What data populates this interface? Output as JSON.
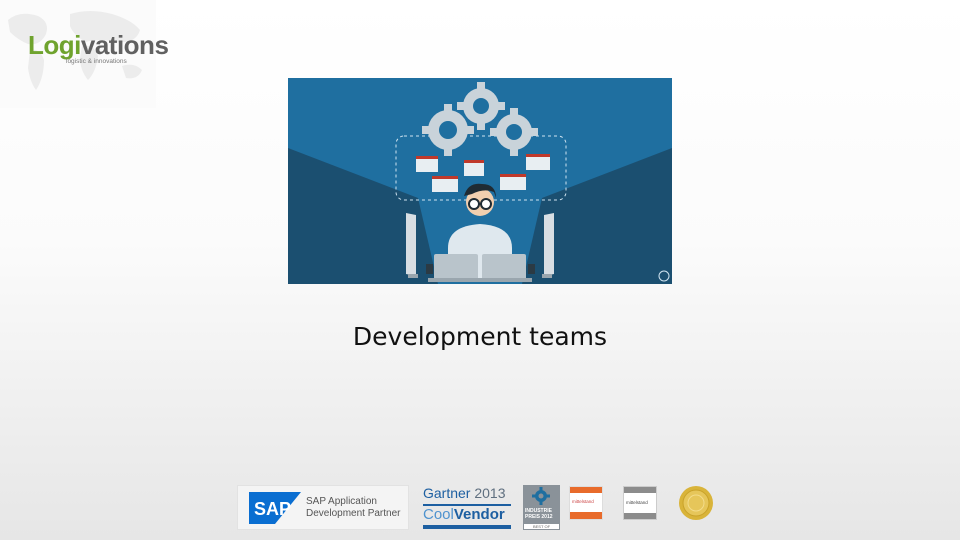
{
  "logo": {
    "brand_part1": "Logi",
    "brand_part2": "vations",
    "tagline": "logistic & innovations"
  },
  "hero": {
    "image_description_name": "developer-illustration"
  },
  "slide": {
    "title": "Development teams"
  },
  "badges": {
    "sap": {
      "mark": "SAP",
      "line1": "SAP Application",
      "line2": "Development Partner"
    },
    "gartner": {
      "brand": "Gartner",
      "year": "2013",
      "cool": "Cool",
      "vendor": "Vendor"
    },
    "industrie": {
      "line1": "INDUSTRIE",
      "line2": "PREIS",
      "year": "2012",
      "best": "BEST OF"
    },
    "innovationspreis_1": {
      "label": "mittelstand"
    },
    "innovationspreis_2": {
      "label": "mittelstand"
    }
  },
  "colors": {
    "brand_green": "#6fa32e",
    "brand_grey": "#616161",
    "hero_blue": "#1f6fa0",
    "sap_blue": "#0a6ed1",
    "gartner_blue": "#1d5fa1"
  }
}
